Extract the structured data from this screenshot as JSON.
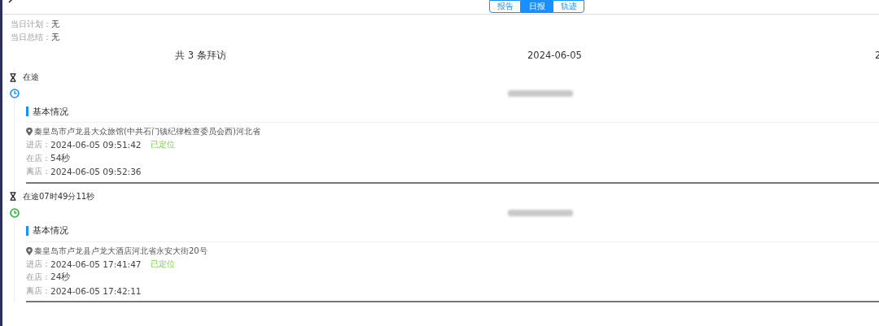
{
  "tabs": [
    {
      "label": "报告",
      "selected": false
    },
    {
      "label": "日报",
      "selected": true
    },
    {
      "label": "轨迹",
      "selected": false
    }
  ],
  "summary": [
    {
      "label": "当日计划：",
      "value": "无"
    },
    {
      "label": "当日总结：",
      "value": "无"
    }
  ],
  "header": {
    "count": "共 3 条拜访",
    "date": "2024-06-05",
    "column_3": "2"
  },
  "timeline": [
    {
      "kind": "travel",
      "text": "在途"
    },
    {
      "kind": "visit",
      "color": "#1890ff",
      "section": "基本情况",
      "address": "秦皇岛市卢龙县大众旅馆(中共石门镇纪律检查委员会西)河北省",
      "rows": [
        {
          "label": "进店：",
          "value": "2024-06-05 09:51:42",
          "status": "已定位"
        },
        {
          "label": "在店：",
          "value": "54秒"
        },
        {
          "label": "离店：",
          "value": "2024-06-05 09:52:36"
        }
      ]
    },
    {
      "kind": "travel",
      "text": "在途07时49分11秒"
    },
    {
      "kind": "visit",
      "color": "#22b33a",
      "section": "基本情况",
      "address": "秦皇岛市卢龙县卢龙大酒店河北省永安大街20号",
      "rows": [
        {
          "label": "进店：",
          "value": "2024-06-05 17:41:47",
          "status": "已定位"
        },
        {
          "label": "在店：",
          "value": "24秒"
        },
        {
          "label": "离店：",
          "value": "2024-06-05 17:42:11"
        }
      ]
    }
  ]
}
